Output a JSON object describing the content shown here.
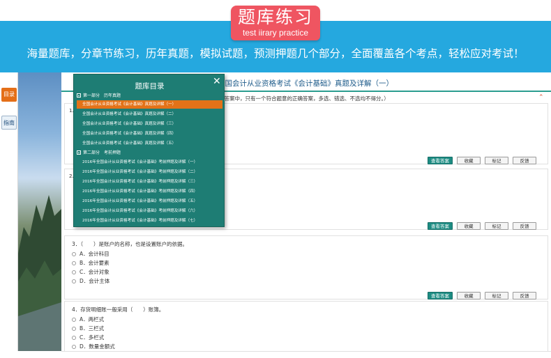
{
  "header": {
    "title": "题库练习",
    "subtitle": "test iirary practice",
    "slogan": "海量题库，分章节练习，历年真题，模拟试题，预测押题几个部分，全面覆盖各个考点，轻松应对考试！"
  },
  "sidebar": {
    "catalog_label": "目录",
    "guide_label": "指南"
  },
  "exam": {
    "title": "全国会计从业资格考试《会计基础》真题及详解（一）",
    "instruction": "选答案中，只有一个符合题意的正确答案，多选、错选、不选均不得分。）"
  },
  "questions": [
    {
      "num": "1.",
      "text": "",
      "options": []
    },
    {
      "num": "2.",
      "text": "",
      "options": []
    },
    {
      "num": "3.",
      "text": "3．（　　）是账户的名称，也是设置账户的依据。",
      "options": [
        "A．会计科目",
        "B．会计要素",
        "C．会计对象",
        "D．会计主体"
      ]
    },
    {
      "num": "4.",
      "text": "4．存货明细账一般采用（　　）账簿。",
      "options": [
        "A．两栏式",
        "B．三栏式",
        "C．多栏式",
        "D．数量金额式"
      ]
    }
  ],
  "actions": {
    "answer": "查看答案",
    "collect": "收藏",
    "mark": "标记",
    "feedback": "反馈"
  },
  "catalog": {
    "title": "题库目录",
    "close": "✕",
    "sections": [
      {
        "name": "第一部分　历年真题",
        "items": [
          "全国会计从业资格考试《会计基础》真题及详解（一）",
          "全国会计从业资格考试《会计基础》真题及详解（二）",
          "全国会计从业资格考试《会计基础》真题及详解（三）",
          "全国会计从业资格考试《会计基础》真题及详解（四）",
          "全国会计从业资格考试《会计基础》真题及详解（五）"
        ]
      },
      {
        "name": "第二部分　考前押题",
        "items": [
          "2016年全国会计从业资格考试《会计基础》考前押题及详解（一）",
          "2016年全国会计从业资格考试《会计基础》考前押题及详解（二）",
          "2016年全国会计从业资格考试《会计基础》考前押题及详解（三）",
          "2016年全国会计从业资格考试《会计基础》考前押题及详解（四）",
          "2016年全国会计从业资格考试《会计基础》考前押题及详解（五）",
          "2016年全国会计从业资格考试《会计基础》考前押题及详解（六）",
          "2016年全国会计从业资格考试《会计基础》考前押题及详解（七）"
        ]
      }
    ]
  }
}
